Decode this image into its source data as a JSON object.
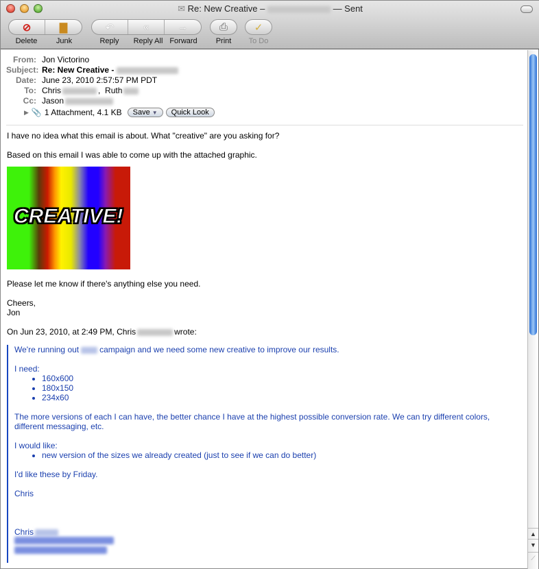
{
  "window": {
    "title": "Re: New Creative –",
    "title_suffix": "— Sent"
  },
  "toolbar": [
    {
      "label": "Delete",
      "icon": "delete-icon"
    },
    {
      "label": "Junk",
      "icon": "junk-icon"
    },
    {
      "label": "Reply",
      "icon": "reply-icon"
    },
    {
      "label": "Reply All",
      "icon": "reply-all-icon"
    },
    {
      "label": "Forward",
      "icon": "forward-icon"
    },
    {
      "label": "Print",
      "icon": "print-icon"
    },
    {
      "label": "To Do",
      "icon": "todo-icon"
    }
  ],
  "header": {
    "from_label": "From:",
    "from": "Jon Victorino",
    "subject_label": "Subject:",
    "subject": "Re: New Creative -",
    "date_label": "Date:",
    "date": "June 23, 2010 2:57:57 PM PDT",
    "to_label": "To:",
    "to_1": "Chris",
    "to_sep": ",",
    "to_2": "Ruth",
    "cc_label": "Cc:",
    "cc": "Jason",
    "attachment": "1 Attachment, 4.1 KB",
    "save": "Save",
    "quick_look": "Quick Look"
  },
  "body": {
    "p1": "I have no idea what this email is about. What \"creative\" are you asking for?",
    "p2": "Based on this email I was able to come up with the attached graphic.",
    "image_text": "CREATIVE!",
    "p3": "Please let me know if there's anything else you need.",
    "p4": "Cheers,",
    "p5": "Jon",
    "attribution_1": "On Jun 23, 2010, at 2:49 PM, Chris",
    "attribution_2": "wrote:"
  },
  "quote": {
    "q1a": "We're running out",
    "q1b": "campaign and we need some new creative to improve our results.",
    "need": "I need:",
    "sizes": [
      "160x600",
      "180x150",
      "234x60"
    ],
    "more": "The more versions of each I can have, the better chance I have at the highest possible conversion rate.  We can try different colors, different messaging, etc.",
    "like": "I would like:",
    "like_items": [
      "new version of the sizes we already created (just to see if we can do better)"
    ],
    "friday": "I'd like these by Friday.",
    "sign": "Chris",
    "sig_name": "Chris"
  }
}
